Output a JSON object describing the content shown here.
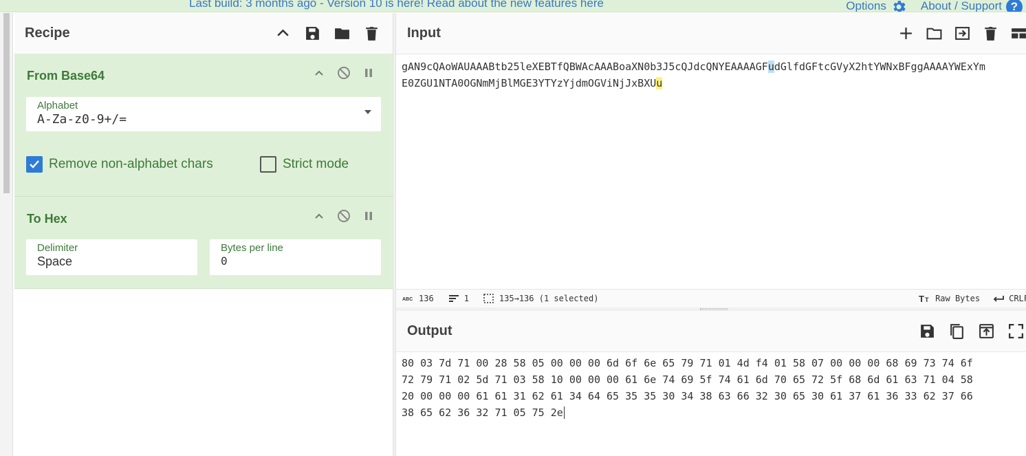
{
  "banner": {
    "text": "Last build: 3 months ago - Version 10 is here! Read about the new features here",
    "options_label": "Options",
    "about_label": "About / Support",
    "help_glyph": "?"
  },
  "recipe": {
    "title": "Recipe",
    "header_icons": [
      "chevron-up-icon",
      "save-icon",
      "folder-icon",
      "trash-icon"
    ],
    "operations": [
      {
        "title": "From Base64",
        "alphabet_label": "Alphabet",
        "alphabet_value": "A-Za-z0-9+/=",
        "remove_label": "Remove non-alphabet chars",
        "remove_checked": true,
        "strict_label": "Strict mode",
        "strict_checked": false
      },
      {
        "title": "To Hex",
        "delimiter_label": "Delimiter",
        "delimiter_value": "Space",
        "bytes_label": "Bytes per line",
        "bytes_value": "0"
      }
    ]
  },
  "input": {
    "title": "Input",
    "line1_a": "gAN9cQAoWAUAAABtb25leXEBTfQBWAcAAABoaXN0b3J5cQJdcQNYEAAAAGF",
    "line1_hl": "u",
    "line1_b": "dGlfdGFtcGVyX2htYWNxBFggAAAAYWExYm",
    "line2_a": "E0ZGU1NTA0OGNmMjBlMGE3YTYzYjdmOGViNjJxBXU",
    "line2_hl": "u"
  },
  "status": {
    "length": "136",
    "lines": "1",
    "selection": "135→136 (1 selected)",
    "raw_bytes": "Raw Bytes",
    "eol": "CRLF"
  },
  "output": {
    "title": "Output",
    "lines": [
      "80 03 7d 71 00 28 58 05 00 00 00 6d 6f 6e 65 79 71 01 4d f4 01 58 07 00 00 00 68 69 73 74 6f",
      "72 79 71 02 5d 71 03 58 10 00 00 00 61 6e 74 69 5f 74 61 6d 70 65 72 5f 68 6d 61 63 71 04 58",
      "20 00 00 00 61 61 31 62 61 34 64 65 35 35 30 34 38 63 66 32 30 65 30 61 37 61 36 33 62 37 66",
      "38 65 62 36 32 71 05 75 2e"
    ]
  },
  "colors": {
    "op_bg": "#dff0d8",
    "op_text": "#3d7a3a",
    "link": "#3a78c2",
    "check_blue": "#2d7bd6"
  }
}
